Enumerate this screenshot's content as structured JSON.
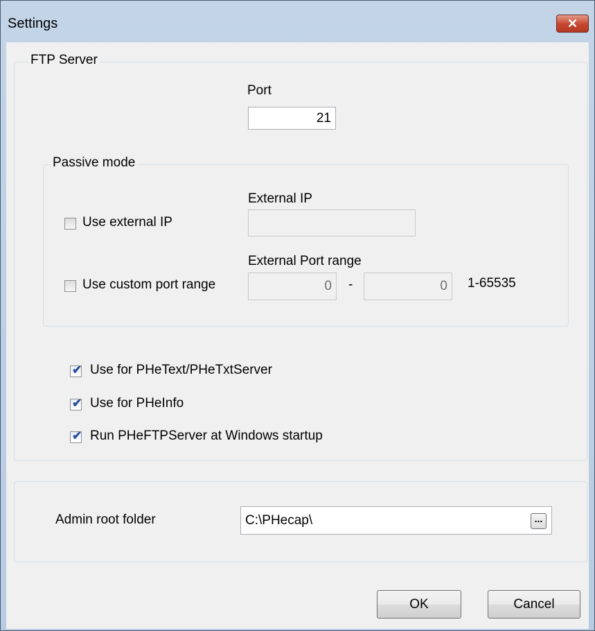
{
  "window": {
    "title": "Settings",
    "close_glyph": "✕"
  },
  "ftp_group": {
    "legend": "FTP Server",
    "port_label": "Port",
    "port_value": "21",
    "passive": {
      "legend": "Passive mode",
      "use_external_ip_label": "Use external IP",
      "use_external_ip_checked": false,
      "external_ip_label": "External IP",
      "external_ip_value": "",
      "use_custom_port_range_label": "Use custom port range",
      "use_custom_port_range_checked": false,
      "external_port_range_label": "External Port range",
      "port_range_from": "0",
      "port_range_separator": "-",
      "port_range_to": "0",
      "port_range_hint": "1-65535"
    },
    "options": [
      {
        "label": "Use for PHeText/PHeTxtServer",
        "checked": true
      },
      {
        "label": "Use for PHeInfo",
        "checked": true
      },
      {
        "label": "Run PHeFTPServer at Windows startup",
        "checked": true
      }
    ]
  },
  "admin": {
    "root_folder_label": "Admin root folder",
    "root_folder_value": "C:\\PHecap\\",
    "browse_label": "..."
  },
  "buttons": {
    "ok": "OK",
    "cancel": "Cancel"
  },
  "icons": {
    "checkmark": "✔",
    "close": "close-icon"
  }
}
